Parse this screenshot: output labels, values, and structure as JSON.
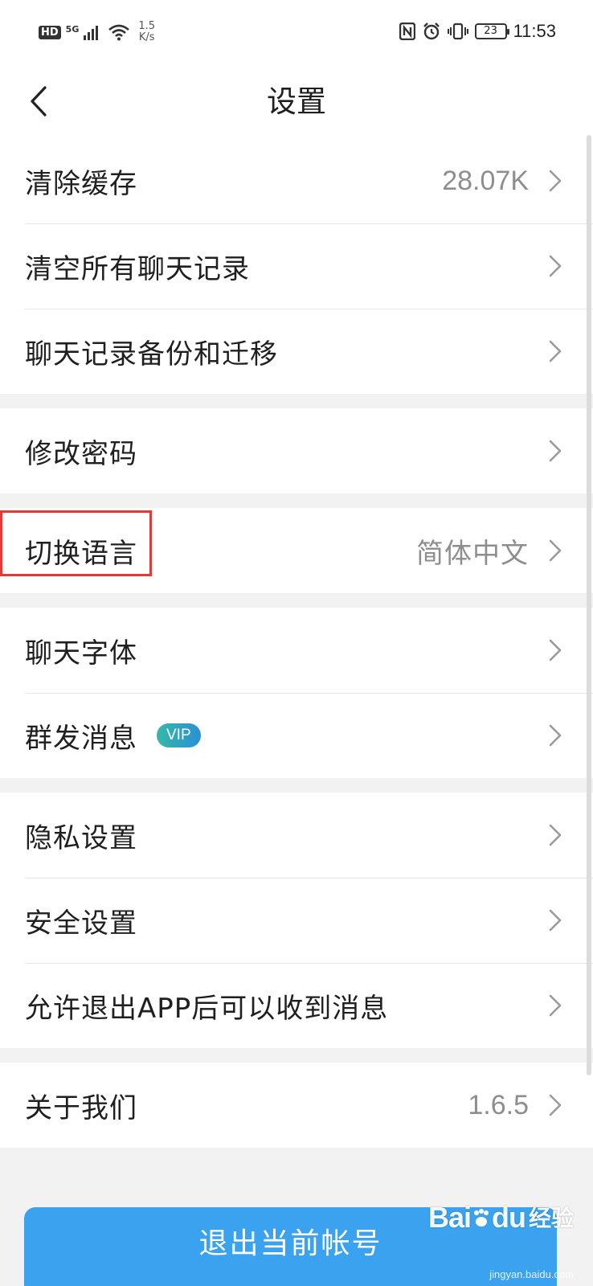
{
  "status_bar": {
    "hd": "HD",
    "network": "5G",
    "speed_value": "1.5",
    "speed_unit": "K/s",
    "battery": "23",
    "time": "11:53"
  },
  "header": {
    "title": "设置",
    "back_icon": "chevron-left-icon"
  },
  "groups": [
    [
      {
        "label": "清除缓存",
        "value": "28.07K"
      },
      {
        "label": "清空所有聊天记录",
        "value": ""
      },
      {
        "label": "聊天记录备份和迁移",
        "value": ""
      }
    ],
    [
      {
        "label": "修改密码",
        "value": ""
      }
    ],
    [
      {
        "label": "切换语言",
        "value": "简体中文"
      }
    ],
    [
      {
        "label": "聊天字体",
        "value": ""
      },
      {
        "label": "群发消息",
        "value": "",
        "badge": "VIP"
      }
    ],
    [
      {
        "label": "隐私设置",
        "value": ""
      },
      {
        "label": "安全设置",
        "value": ""
      },
      {
        "label": "允许退出APP后可以收到消息",
        "value": ""
      }
    ],
    [
      {
        "label": "关于我们",
        "value": "1.6.5"
      }
    ]
  ],
  "logout_button": "退出当前帐号",
  "watermark": {
    "logo": "Bai",
    "logo_suffix": "du",
    "suffix": "经验",
    "url": "jingyan.baidu.com"
  },
  "colors": {
    "accent": "#3aa2ee",
    "highlight": "#e53935",
    "vip_start": "#35b9a6",
    "vip_end": "#2a8fd6"
  }
}
